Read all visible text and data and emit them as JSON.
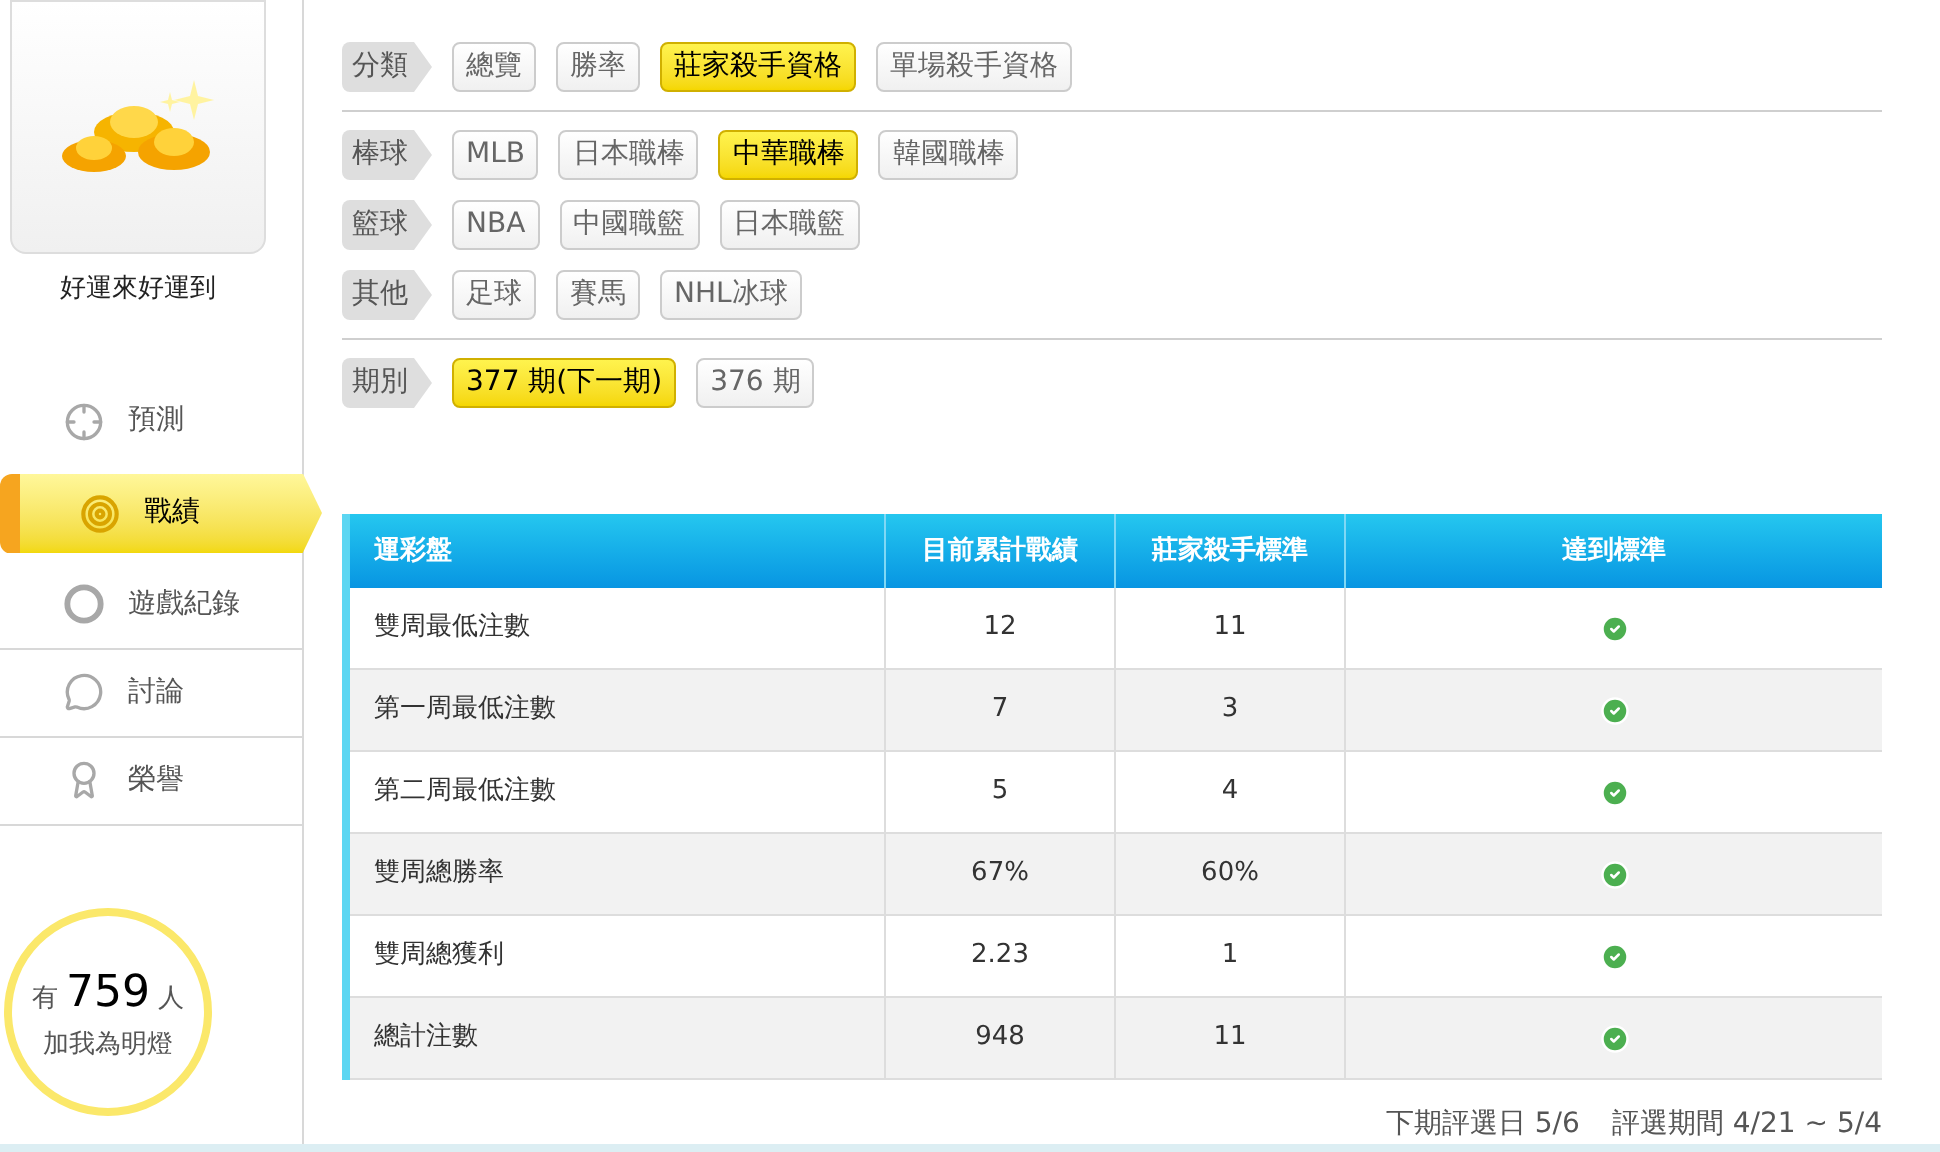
{
  "profile": {
    "name": "好運來好運到"
  },
  "nav": [
    {
      "label": "預測",
      "kind": "crosshair",
      "selected": false
    },
    {
      "label": "戰績",
      "kind": "target",
      "selected": true
    },
    {
      "label": "遊戲紀錄",
      "kind": "ring",
      "selected": false
    },
    {
      "label": "討論",
      "kind": "chat",
      "selected": false
    },
    {
      "label": "榮譽",
      "kind": "medal",
      "selected": false
    }
  ],
  "fans": {
    "prefix": "有",
    "count": "759",
    "suffix": "人",
    "caption": "加我為明燈"
  },
  "filter_sections": [
    [
      {
        "label": "分類",
        "options": [
          {
            "label": "總覽",
            "selected": false
          },
          {
            "label": "勝率",
            "selected": false
          },
          {
            "label": "莊家殺手資格",
            "selected": true
          },
          {
            "label": "單場殺手資格",
            "selected": false
          }
        ]
      }
    ],
    [
      {
        "label": "棒球",
        "options": [
          {
            "label": "MLB",
            "selected": false
          },
          {
            "label": "日本職棒",
            "selected": false
          },
          {
            "label": "中華職棒",
            "selected": true
          },
          {
            "label": "韓國職棒",
            "selected": false
          }
        ]
      },
      {
        "label": "籃球",
        "options": [
          {
            "label": "NBA",
            "selected": false
          },
          {
            "label": "中國職籃",
            "selected": false
          },
          {
            "label": "日本職籃",
            "selected": false
          }
        ]
      },
      {
        "label": "其他",
        "options": [
          {
            "label": "足球",
            "selected": false
          },
          {
            "label": "賽馬",
            "selected": false
          },
          {
            "label": "NHL冰球",
            "selected": false
          }
        ]
      }
    ],
    [
      {
        "label": "期別",
        "options": [
          {
            "label": "377 期(下一期)",
            "selected": true
          },
          {
            "label": "376 期",
            "selected": false
          }
        ]
      }
    ]
  ],
  "table": {
    "columns": [
      "運彩盤",
      "目前累計戰績",
      "莊家殺手標準",
      "達到標準"
    ],
    "rows": [
      {
        "item": "雙周最低注數",
        "current": "12",
        "standard": "11",
        "met": true
      },
      {
        "item": "第一周最低注數",
        "current": "7",
        "standard": "3",
        "met": true
      },
      {
        "item": "第二周最低注數",
        "current": "5",
        "standard": "4",
        "met": true
      },
      {
        "item": "雙周總勝率",
        "current": "67%",
        "standard": "60%",
        "met": true
      },
      {
        "item": "雙周總獲利",
        "current": "2.23",
        "standard": "1",
        "met": true
      },
      {
        "item": "總計注數",
        "current": "948",
        "standard": "11",
        "met": true
      }
    ]
  },
  "footer": [
    "下期評選日 5/6",
    "評選期間 4/21 ~ 5/4"
  ]
}
